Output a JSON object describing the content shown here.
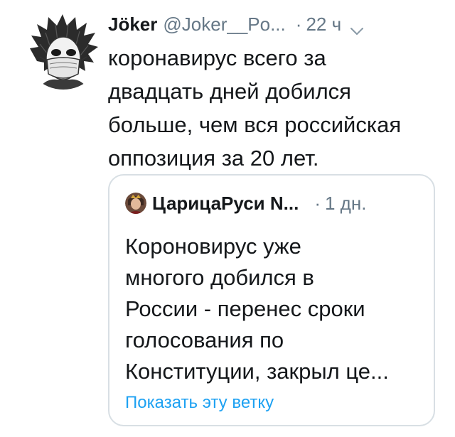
{
  "tweet": {
    "author_name": "Jöker",
    "handle": "@Joker__Po...",
    "separator": "·",
    "time": "22 ч",
    "lines": [
      "коронавирус всего за",
      "двадцать дней добился",
      "больше, чем вся российская",
      "оппозиция за 20 лет."
    ]
  },
  "quote": {
    "author_name": "ЦарицаРуси N...",
    "separator": "·",
    "time": "1 дн.",
    "lines": [
      "Короновирус уже",
      "многого добился в",
      "России - перенес сроки",
      "голосования по",
      "Конституции, закрыл це..."
    ],
    "show_thread": "Показать эту ветку"
  },
  "colors": {
    "text": "#14171a",
    "secondary": "#657786",
    "link": "#1da1f2",
    "border": "#d8dfe4"
  },
  "icons": {
    "caret": "chevron-down-icon",
    "author_avatar": "joker-masked-avatar",
    "quote_avatar": "queen-avatar"
  }
}
